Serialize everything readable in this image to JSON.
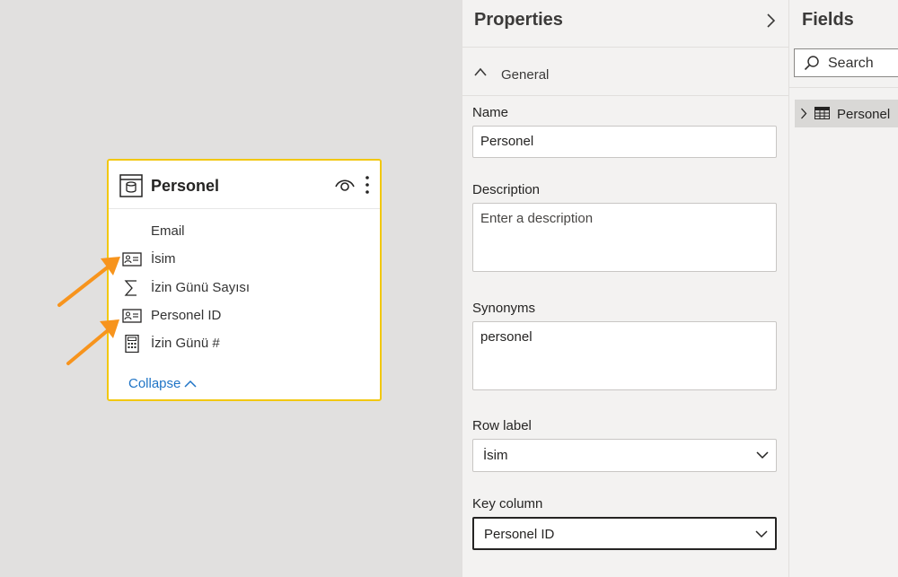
{
  "canvas": {
    "card": {
      "title": "Personel",
      "fields": [
        {
          "label": "Email",
          "icon": ""
        },
        {
          "label": "İsim",
          "icon": "contact-card-icon"
        },
        {
          "label": "İzin Günü Sayısı",
          "icon": "sigma-icon"
        },
        {
          "label": "Personel ID",
          "icon": "contact-card-icon"
        },
        {
          "label": "İzin Günü #",
          "icon": "calculator-icon"
        }
      ],
      "collapse_label": "Collapse"
    },
    "accent_color": "#f2c811",
    "arrow_color": "#f7941d"
  },
  "properties": {
    "title": "Properties",
    "section": "General",
    "name_label": "Name",
    "name_value": "Personel",
    "description_label": "Description",
    "description_placeholder": "Enter a description",
    "synonyms_label": "Synonyms",
    "synonyms_value": "personel",
    "row_label_label": "Row label",
    "row_label_value": "İsim",
    "key_column_label": "Key column",
    "key_column_value": "Personel ID"
  },
  "fields_pane": {
    "title": "Fields",
    "search_placeholder": "Search",
    "tables": [
      {
        "label": "Personel"
      }
    ]
  }
}
